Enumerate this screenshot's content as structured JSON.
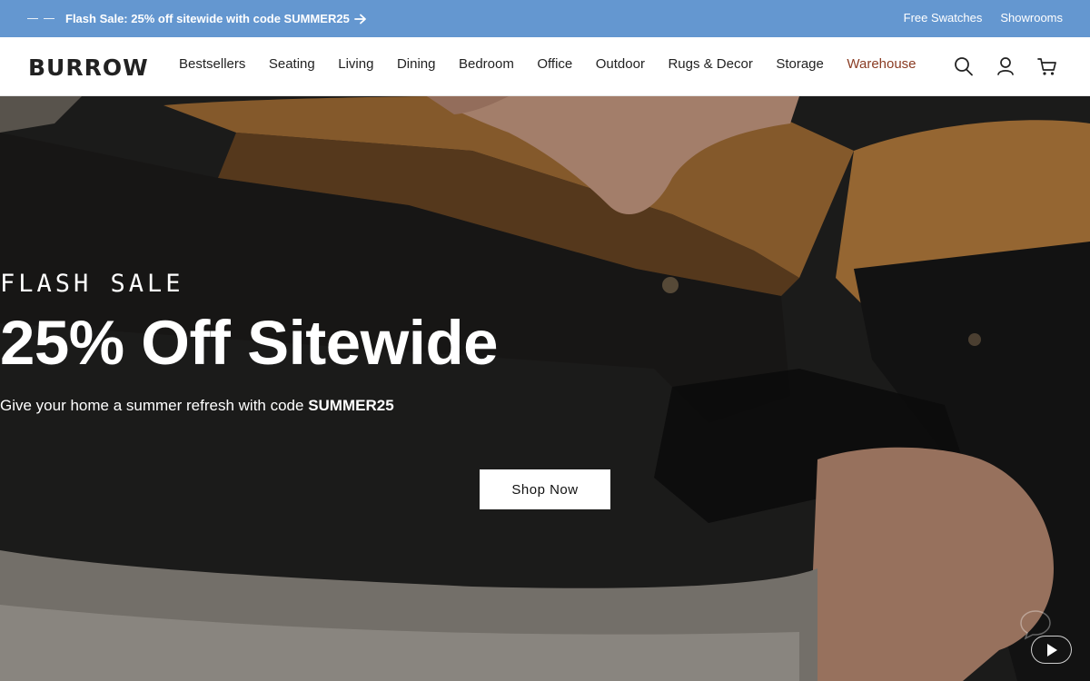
{
  "promo_bar": {
    "message": "Flash Sale: 25% off sitewide with code SUMMER25",
    "links": [
      "Free Swatches",
      "Showrooms"
    ],
    "background_color": "#6497d0"
  },
  "header": {
    "logo": "BURROW",
    "nav": [
      {
        "label": "Bestsellers"
      },
      {
        "label": "Seating"
      },
      {
        "label": "Living"
      },
      {
        "label": "Dining"
      },
      {
        "label": "Bedroom"
      },
      {
        "label": "Office"
      },
      {
        "label": "Outdoor"
      },
      {
        "label": "Rugs & Decor"
      },
      {
        "label": "Storage"
      },
      {
        "label": "Warehouse",
        "color": "#8a3b22"
      }
    ],
    "icons": [
      "search-icon",
      "account-icon",
      "cart-icon"
    ]
  },
  "hero": {
    "eyebrow": "FLASH SALE",
    "headline": "25% Off Sitewide",
    "subline_text": "Give your home a summer refresh with code ",
    "subline_code": "SUMMER25",
    "cta_label": "Shop Now",
    "video_control_icon": "play-icon"
  }
}
